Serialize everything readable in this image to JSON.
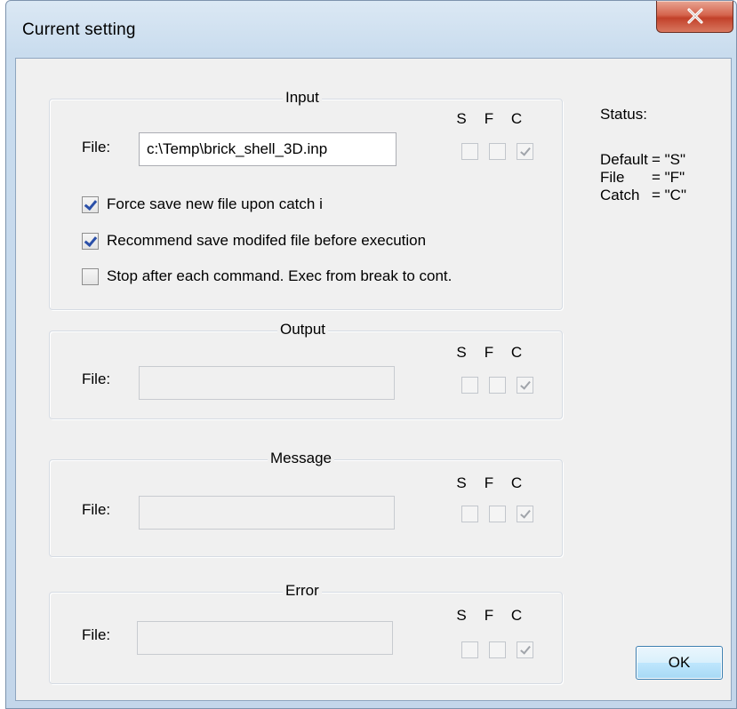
{
  "window": {
    "title": "Current setting"
  },
  "sfc_headers": [
    "S",
    "F",
    "C"
  ],
  "file_label": "File:",
  "groups": {
    "input": {
      "legend": "Input",
      "file_value": "c:\\Temp\\brick_shell_3D.inp",
      "sfc": [
        false,
        false,
        true
      ]
    },
    "output": {
      "legend": "Output",
      "file_value": "",
      "sfc": [
        false,
        false,
        true
      ]
    },
    "message": {
      "legend": "Message",
      "file_value": "",
      "sfc": [
        false,
        false,
        true
      ]
    },
    "error": {
      "legend": "Error",
      "file_value": "",
      "sfc": [
        false,
        false,
        true
      ]
    }
  },
  "options": [
    {
      "label": "Force save new file upon catch i",
      "checked": true
    },
    {
      "label": "Recommend save modifed file before execution",
      "checked": true
    },
    {
      "label": "Stop after each command. Exec from break to cont.",
      "checked": false
    }
  ],
  "status": {
    "title": "Status:",
    "rows": [
      {
        "key": "Default",
        "value": "= \"S\""
      },
      {
        "key": "File",
        "value": "= \"F\""
      },
      {
        "key": "Catch",
        "value": "= \"C\""
      }
    ]
  },
  "buttons": {
    "ok": "OK"
  },
  "colors": {
    "checkmark": "#2a4fa8",
    "close_button": "#c2412a",
    "ok_border": "#3c7fb1"
  }
}
